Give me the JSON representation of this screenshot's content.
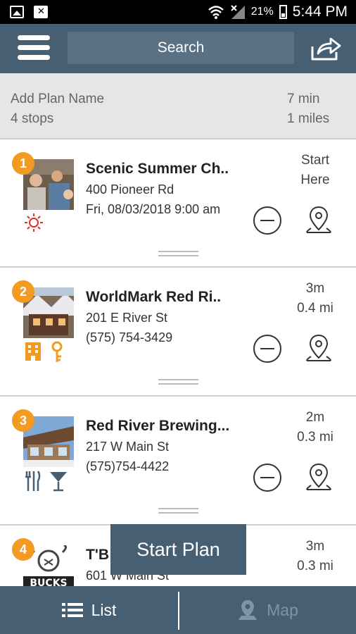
{
  "status_bar": {
    "battery": "21%",
    "time": "5:44 PM",
    "icons": [
      "gallery-icon",
      "close-box-icon",
      "wifi-icon",
      "signal-icon",
      "battery-icon"
    ]
  },
  "header": {
    "search_label": "Search",
    "menu_icon": "hamburger-icon",
    "share_icon": "share-icon"
  },
  "plan": {
    "name_placeholder": "Add Plan Name",
    "stops_count": "4 stops",
    "total_time": "7 min",
    "total_distance": "1 miles"
  },
  "stops": [
    {
      "number": "1",
      "name": "Scenic Summer Ch..",
      "address": "400 Pioneer Rd",
      "info": "Fri, 08/03/2018 9:00 am",
      "right_line1": "Start",
      "right_line2": "Here",
      "amenities": [
        "sun-icon"
      ]
    },
    {
      "number": "2",
      "name": "WorldMark Red Ri..",
      "address": "201 E River St",
      "info": "(575) 754-3429",
      "right_line1": "3m",
      "right_line2": "0.4 mi",
      "amenities": [
        "building-icon",
        "key-icon"
      ]
    },
    {
      "number": "3",
      "name": "Red River Brewing...",
      "address": "217 W Main St",
      "info": "(575)754-4422",
      "right_line1": "2m",
      "right_line2": "0.3 mi",
      "amenities": [
        "restaurant-icon",
        "cocktail-icon"
      ]
    },
    {
      "number": "4",
      "name": "T'B",
      "address": "601 W Main St",
      "info": "",
      "right_line1": "3m",
      "right_line2": "0.3 mi",
      "amenities": []
    }
  ],
  "start_plan_label": "Start Plan",
  "bottom_nav": {
    "list_label": "List",
    "map_label": "Map"
  },
  "colors": {
    "header": "#475f73",
    "accent_badge": "#f39a22",
    "amenity_orange": "#f39a22",
    "amenity_navy": "#475f73",
    "sun_red": "#d9352b"
  }
}
